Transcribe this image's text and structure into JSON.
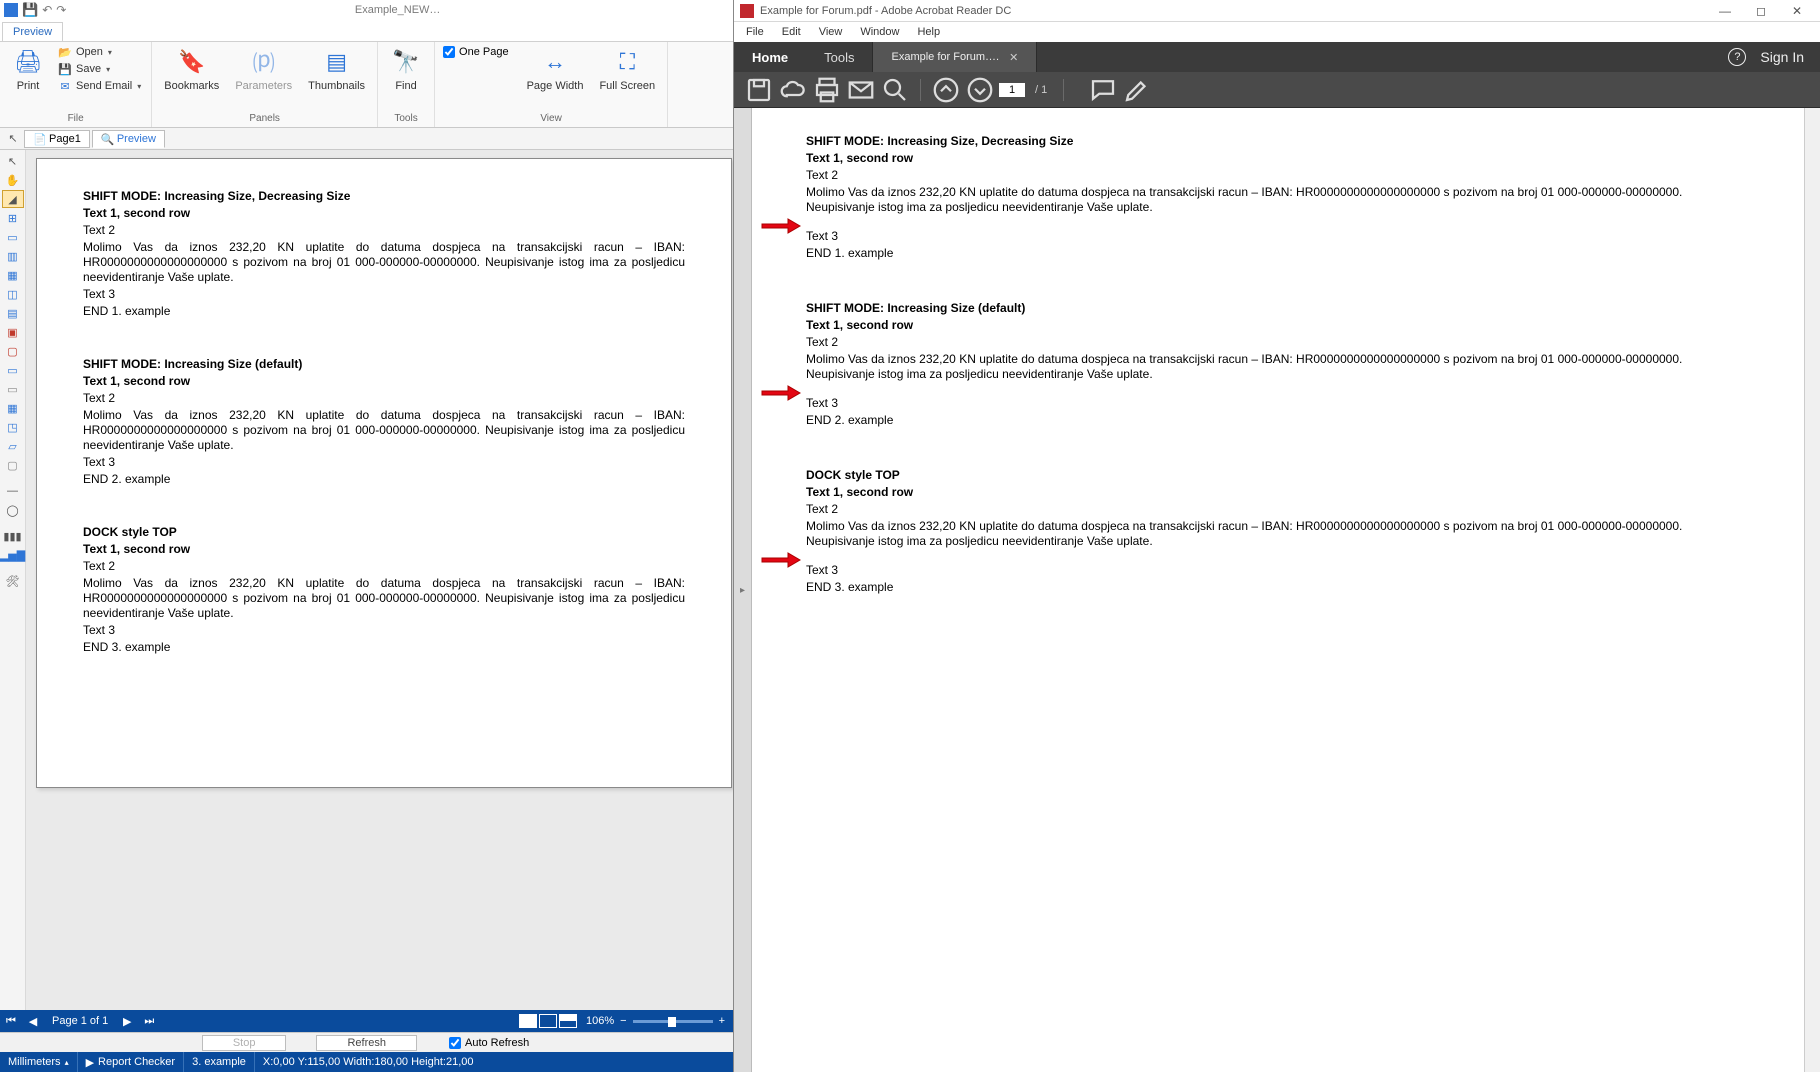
{
  "left": {
    "title": "Example_NEW…",
    "ribbon_tab": "Preview",
    "file": {
      "print": "Print",
      "open": "Open",
      "save": "Save",
      "send_email": "Send Email",
      "group": "File"
    },
    "panels": {
      "bookmarks": "Bookmarks",
      "parameters": "Parameters",
      "thumbnails": "Thumbnails",
      "group": "Panels"
    },
    "tools": {
      "find": "Find",
      "group": "Tools"
    },
    "view": {
      "one_page": "One Page",
      "page_width": "Page Width",
      "full_screen": "Full Screen",
      "group": "View"
    },
    "doc_tabs": {
      "page1": "Page1",
      "preview": "Preview"
    },
    "pager": {
      "text": "Page 1 of 1",
      "zoom": "106%"
    },
    "refresh": {
      "stop": "Stop",
      "refresh": "Refresh",
      "auto": "Auto Refresh"
    },
    "status": {
      "units": "Millimeters",
      "checker": "Report Checker",
      "example": "3. example",
      "coords": "X:0,00  Y:115,00  Width:180,00  Height:21,00"
    }
  },
  "right": {
    "title": "Example for Forum.pdf - Adobe Acrobat Reader DC",
    "menu": [
      "File",
      "Edit",
      "View",
      "Window",
      "Help"
    ],
    "tabs": {
      "home": "Home",
      "tools": "Tools",
      "doc": "Example for Forum…."
    },
    "signin": "Sign In",
    "page_current": "1",
    "page_total": "/  1"
  },
  "content": {
    "blocks": [
      {
        "title": "SHIFT MODE: Increasing Size, Decreasing Size",
        "row2": "Text 1, second row",
        "row3": "Text 2",
        "long_left": "Molimo Vas da iznos 232,20 KN uplatite do datuma dospjeca na transakcijski racun – IBAN: HR0000000000000000000 s pozivom na broj 01 000-000000-00000000. Neupisivanje istog ima za posljedicu neevidentiranje Vaše uplate.",
        "long_right": "Molimo Vas da iznos 232,20 KN uplatite do datuma dospjeca na transakcijski racun – IBAN: HR0000000000000000000 s pozivom na broj 01 000-000000-00000000. Neupisivanje istog ima za posljedicu neevidentiranje Vaše uplate.",
        "row5": "Text 3",
        "row6": "END 1. example"
      },
      {
        "title": "SHIFT MODE: Increasing Size (default)",
        "row2": "Text 1, second row",
        "row3": "Text 2",
        "long_left": "Molimo Vas da iznos 232,20 KN uplatite do datuma dospjeca na transakcijski racun – IBAN: HR0000000000000000000 s pozivom na broj 01 000-000000-00000000. Neupisivanje istog ima za posljedicu neevidentiranje Vaše uplate.",
        "long_right": "Molimo Vas da iznos 232,20 KN uplatite do datuma dospjeca na transakcijski racun – IBAN: HR0000000000000000000 s pozivom na broj 01 000-000000-00000000. Neupisivanje istog ima za posljedicu neevidentiranje Vaše uplate.",
        "row5": "Text 3",
        "row6": "END 2. example"
      },
      {
        "title": "DOCK style TOP",
        "row2": "Text 1, second row",
        "row3": "Text 2",
        "long_left": "Molimo Vas da iznos 232,20 KN uplatite do datuma dospjeca na transakcijski racun – IBAN: HR0000000000000000000 s pozivom na broj 01 000-000000-00000000. Neupisivanje istog ima za posljedicu neevidentiranje Vaše uplate.",
        "long_right": "Molimo Vas da iznos 232,20 KN uplatite do datuma dospjeca na transakcijski racun – IBAN: HR0000000000000000000 s pozivom na broj 01 000-000000-00000000. Neupisivanje istog ima za posljedicu neevidentiranje Vaše uplate.",
        "row5": "Text 3",
        "row6": "END 3. example"
      }
    ]
  }
}
